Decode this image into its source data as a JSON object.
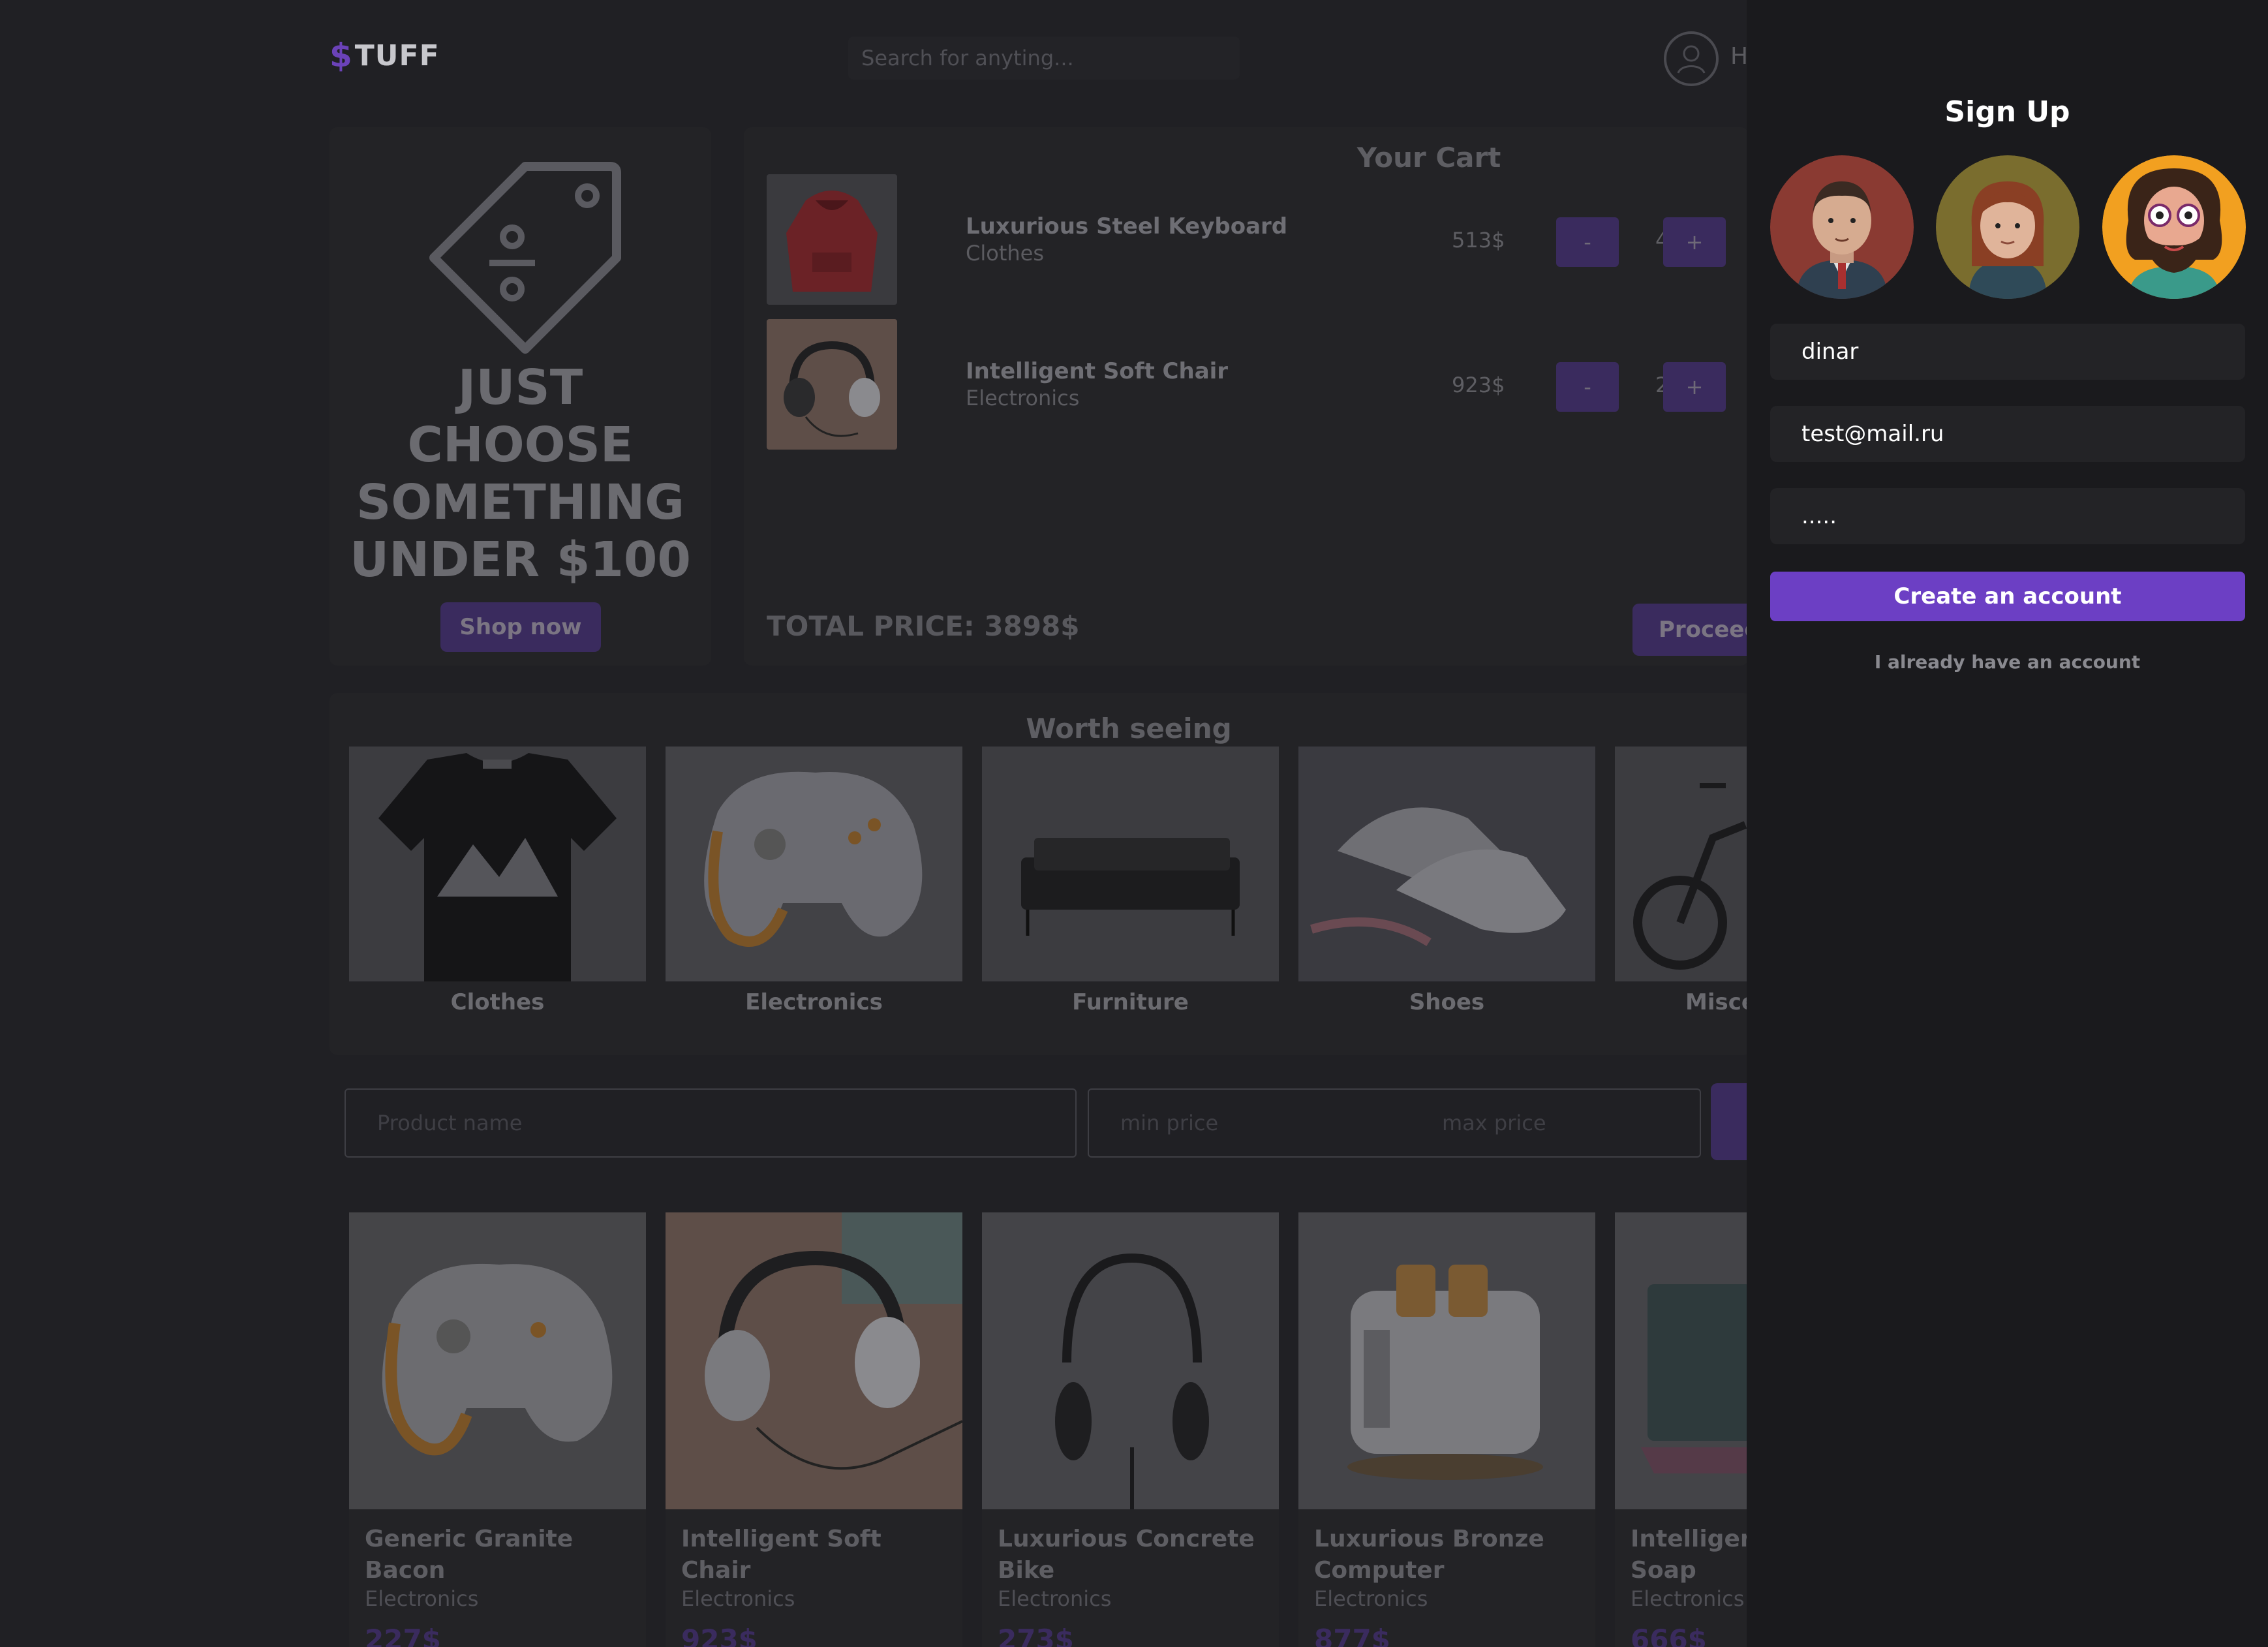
{
  "header": {
    "logo_symbol": "$",
    "logo_text": "TUFF",
    "search_placeholder": "Search for anyting...",
    "user_name_peek": "H"
  },
  "promo": {
    "title_lines": [
      "JUST",
      "CHOOSE",
      "SOMETHING",
      "UNDER $100"
    ],
    "button": "Shop now"
  },
  "cart": {
    "title": "Your Cart",
    "items": [
      {
        "name": "Luxurious Steel Keyboard",
        "category": "Clothes",
        "price": "513$",
        "qty": "4"
      },
      {
        "name": "Intelligent Soft Chair",
        "category": "Electronics",
        "price": "923$",
        "qty": "2"
      }
    ],
    "minus": "-",
    "plus": "+",
    "total": "TOTAL PRICE: 3898$",
    "proceed": "Proceed"
  },
  "worth": {
    "title": "Worth seeing",
    "categories": [
      "Clothes",
      "Electronics",
      "Furniture",
      "Shoes",
      "Misce"
    ]
  },
  "filters": {
    "product_name_placeholder": "Product name",
    "min_price_placeholder": "min price",
    "max_price_placeholder": "max price"
  },
  "products": [
    {
      "name": "Generic Granite Bacon",
      "category": "Electronics",
      "price": "227$"
    },
    {
      "name": "Intelligent Soft Chair",
      "category": "Electronics",
      "price": "923$"
    },
    {
      "name": "Luxurious Concrete Bike",
      "category": "Electronics",
      "price": "273$"
    },
    {
      "name": "Luxurious Bronze Computer",
      "category": "Electronics",
      "price": "877$"
    },
    {
      "name": "Intelligent Soap",
      "category": "Electronics",
      "price": "666$"
    }
  ],
  "signup": {
    "title": "Sign Up",
    "name_value": "dinar",
    "email_value": "test@mail.ru",
    "password_value": ".....",
    "create_button": "Create an account",
    "already_link": "I already have an account"
  },
  "colors": {
    "accent": "#6c3fc4",
    "background": "#202024",
    "modal": "#1a1a1d"
  }
}
